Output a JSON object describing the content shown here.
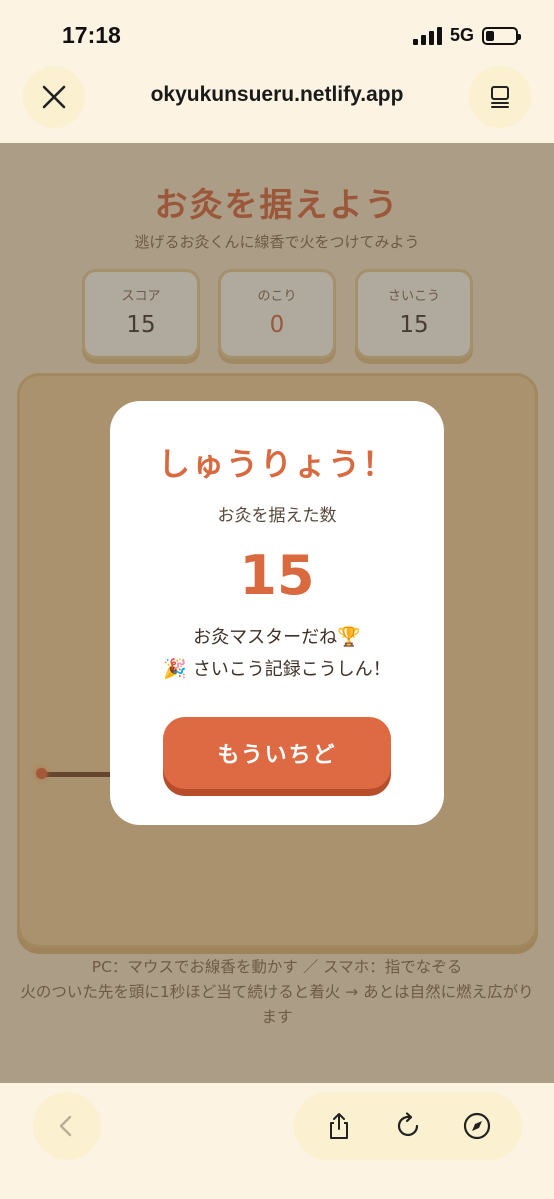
{
  "status_bar": {
    "time": "17:18",
    "network": "5G"
  },
  "browser": {
    "url": "okyukunsueru.netlify.app"
  },
  "page": {
    "title": "お灸を据えよう",
    "subtitle": "逃げるお灸くんに線香で火をつけてみよう",
    "stats": {
      "score_label": "スコア",
      "score_value": "15",
      "left_label": "のこり",
      "left_value": "0",
      "best_label": "さいこう",
      "best_value": "15"
    },
    "instructions_line1": "PC：マウスでお線香を動かす ／ スマホ：指でなぞる",
    "instructions_line2": "火のついた先を頭に1秒ほど当て続けると着火 → あとは自然に燃え広がります"
  },
  "modal": {
    "title": "しゅうりょう！",
    "subtitle": "お灸を据えた数",
    "count": "15",
    "message1": "お灸マスターだね",
    "message1_emoji": "🏆",
    "message2_emoji": "🎉",
    "message2": "さいこう記録こうしん！",
    "retry_label": "もういちど"
  },
  "colors": {
    "accent": "#dd6a43",
    "background": "#fcf3e2"
  }
}
